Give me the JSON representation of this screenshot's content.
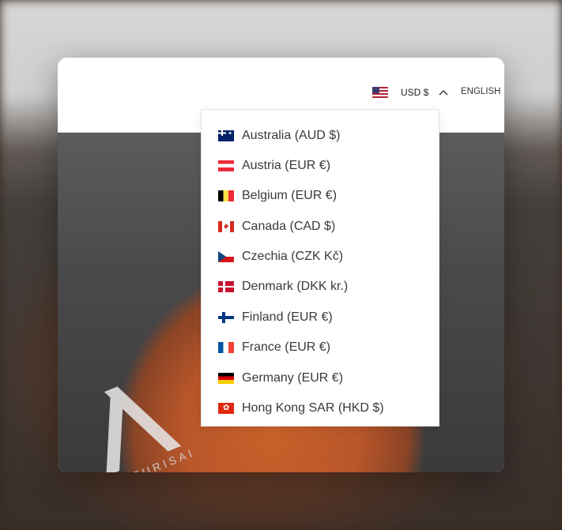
{
  "header": {
    "currency_selector": {
      "flag_icon": "us-flag-icon",
      "label": "USD $",
      "expanded_icon": "chevron-up-icon"
    },
    "language_label": "ENGLISH"
  },
  "hero": {
    "logo_text": "VENTURISAI"
  },
  "currency_dropdown": {
    "options": [
      {
        "label": "Australia (AUD $)",
        "flag": "au-flag-icon"
      },
      {
        "label": "Austria (EUR €)",
        "flag": "at-flag-icon"
      },
      {
        "label": "Belgium (EUR €)",
        "flag": "be-flag-icon"
      },
      {
        "label": "Canada (CAD $)",
        "flag": "ca-flag-icon"
      },
      {
        "label": "Czechia (CZK Kč)",
        "flag": "cz-flag-icon"
      },
      {
        "label": "Denmark (DKK kr.)",
        "flag": "dk-flag-icon"
      },
      {
        "label": "Finland (EUR €)",
        "flag": "fi-flag-icon"
      },
      {
        "label": "France (EUR €)",
        "flag": "fr-flag-icon"
      },
      {
        "label": "Germany (EUR €)",
        "flag": "de-flag-icon"
      },
      {
        "label": "Hong Kong SAR (HKD $)",
        "flag": "hk-flag-icon"
      }
    ]
  },
  "colors": {
    "text": "#3a3a3a",
    "border": "#e3e3e3",
    "hero_accent": "#c8622a"
  }
}
